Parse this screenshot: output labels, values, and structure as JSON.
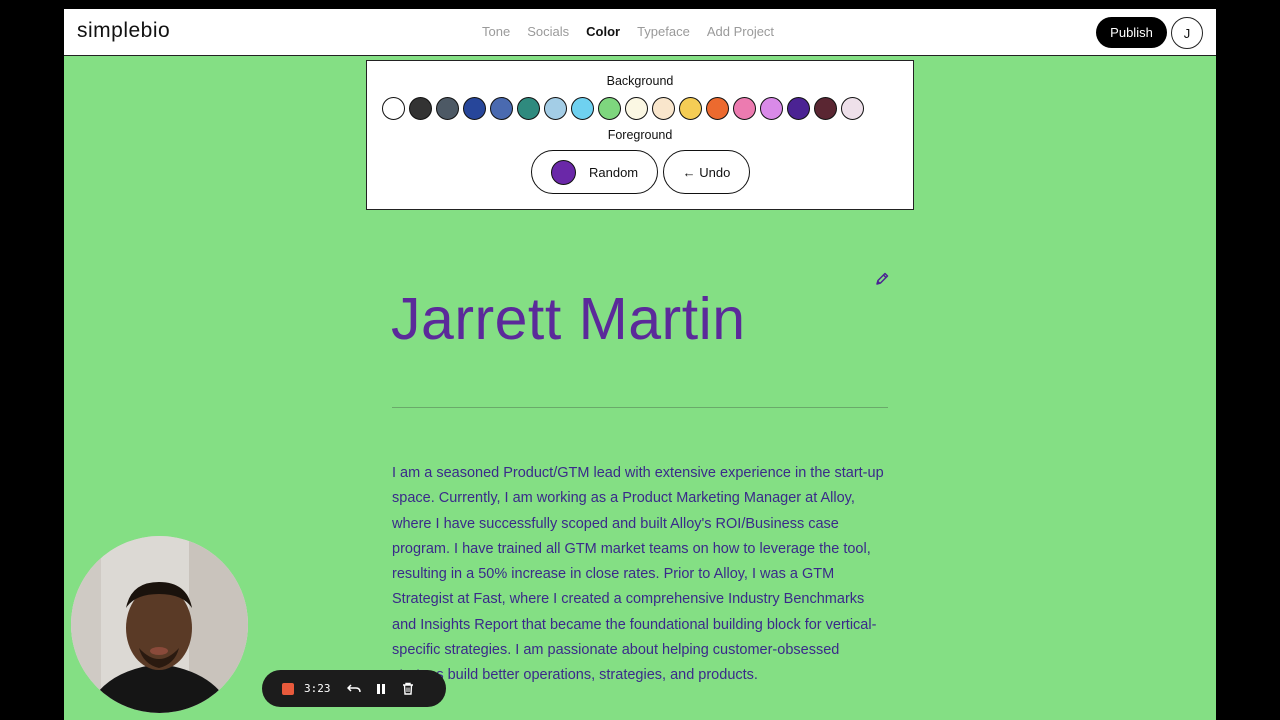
{
  "topbar": {
    "logo": "simplebio",
    "nav": [
      "Tone",
      "Socials",
      "Color",
      "Typeface",
      "Add Project"
    ],
    "active_nav": "Color",
    "publish_label": "Publish",
    "avatar_initial": "J"
  },
  "color_panel": {
    "background_label": "Background",
    "foreground_label": "Foreground",
    "swatches": [
      "#ffffff",
      "#333333",
      "#4d5965",
      "#27469a",
      "#4a6ab0",
      "#2f8a7e",
      "#a3cde6",
      "#6fd1f0",
      "#7ed67e",
      "#fbf7e3",
      "#f9e6cc",
      "#f5cd55",
      "#ec6a2f",
      "#ec7bb0",
      "#d98ae8",
      "#4b2393",
      "#5a2632",
      "#eee0ea"
    ],
    "random_label": "Random",
    "random_color": "#6a28a8",
    "undo_label": "← Undo"
  },
  "profile": {
    "name": "Jarrett Martin",
    "bio": "I am a seasoned Product/GTM lead with extensive experience in the start-up space. Currently, I am working as a Product Marketing Manager at Alloy, where I have successfully scoped and built Alloy's ROI/Business case program. I have trained all GTM market teams on how to leverage the tool, resulting in a 50% increase in close rates. Prior to Alloy, I was a GTM Strategist at Fast, where I created a comprehensive Industry Benchmarks and Insights Report that became the foundational building block for vertical-specific strategies. I am passionate about helping customer-obsessed startups build better operations, strategies, and products.",
    "name_color": "#5b2a9a"
  },
  "recorder": {
    "time": "3:23"
  },
  "colors": {
    "page_background": "#84df84"
  }
}
